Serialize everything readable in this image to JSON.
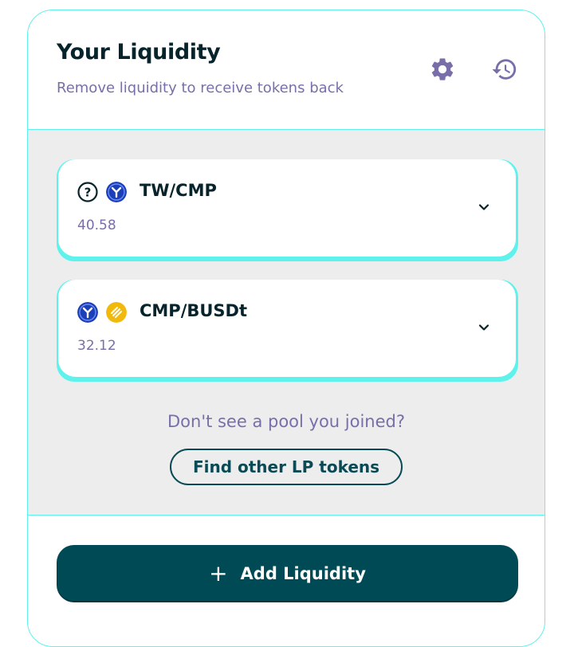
{
  "header": {
    "title": "Your Liquidity",
    "subtitle": "Remove liquidity to receive tokens back",
    "settings_icon": "gear-icon",
    "history_icon": "history-icon"
  },
  "pools": [
    {
      "pair": "TW/CMP",
      "amount": "40.58",
      "tokens": [
        "question-circle-icon",
        "cmp-token-icon"
      ]
    },
    {
      "pair": "CMP/BUSDt",
      "amount": "32.12",
      "tokens": [
        "cmp-token-icon",
        "busdt-token-icon"
      ]
    }
  ],
  "notice": {
    "text": "Don't see a pool you joined?",
    "button_label": "Find other LP tokens"
  },
  "add": {
    "label": "Add Liquidity",
    "icon": "plus-icon"
  },
  "colors": {
    "accent": "#5ef2ec",
    "primary": "#004a56",
    "text_dark": "#07232b",
    "text_muted": "#7a6eaa",
    "panel_bg": "#ededee",
    "cmp_blue": "#1a3fb8",
    "busdt_yellow": "#f0b90b"
  }
}
